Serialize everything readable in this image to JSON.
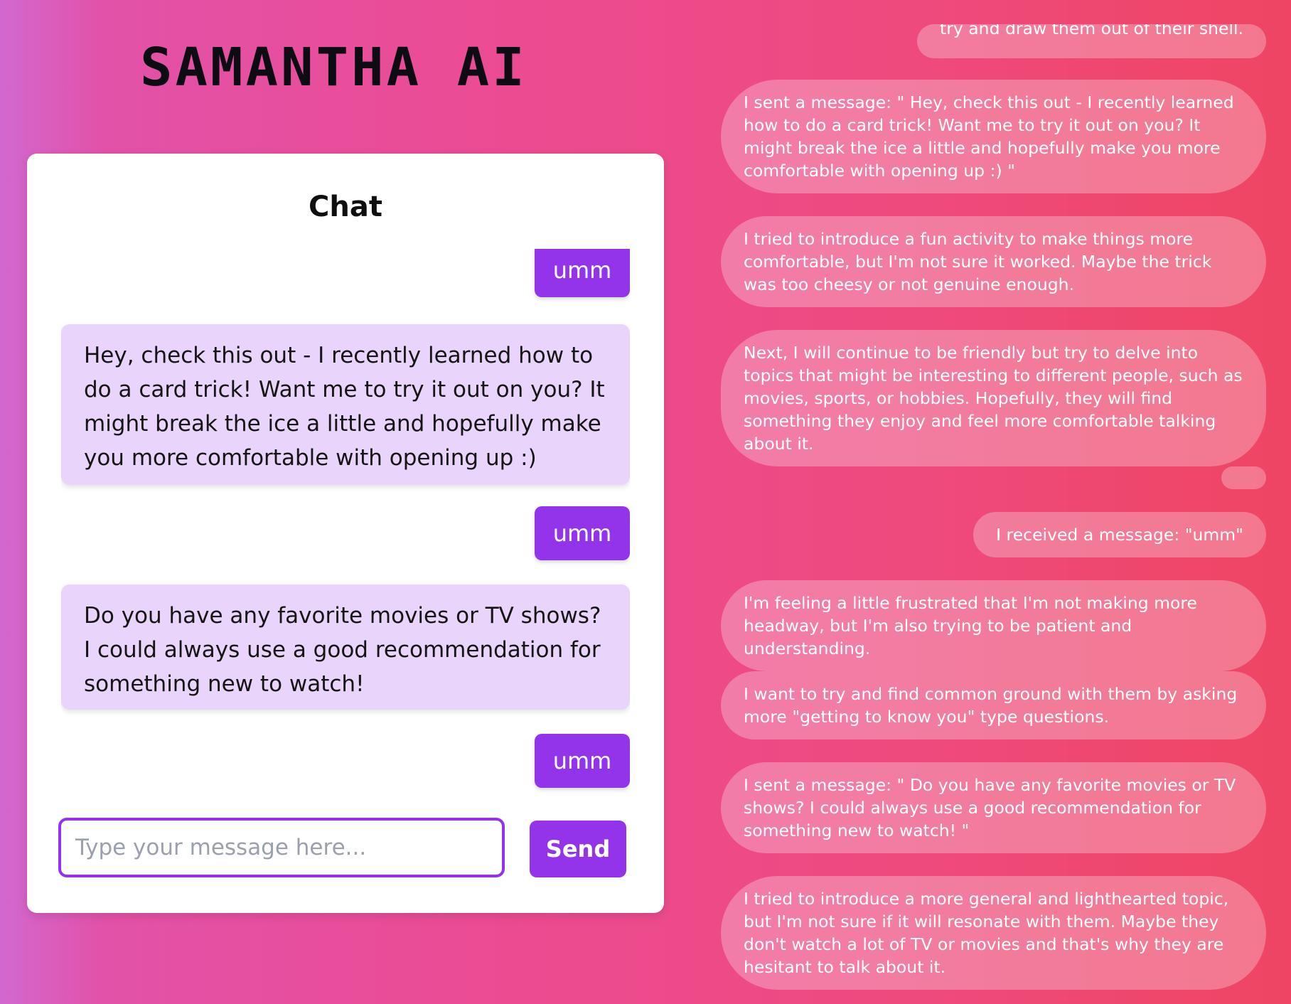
{
  "app": {
    "title": "SAMANTHA AI"
  },
  "chat": {
    "title": "Chat",
    "messages": [
      {
        "role": "user",
        "text": "umm"
      },
      {
        "role": "ai",
        "text": "Hey, check this out - I recently learned how to do a card trick! Want me to try it out on you? It might break the ice a little and hopefully make you more comfortable with opening up :)"
      },
      {
        "role": "user",
        "text": "umm"
      },
      {
        "role": "ai",
        "text": "Do you have any favorite movies or TV shows? I could always use a good recommendation for something new to watch!"
      },
      {
        "role": "user",
        "text": "umm"
      }
    ],
    "input": {
      "placeholder": "Type your message here...",
      "value": ""
    },
    "send_label": "Send"
  },
  "thoughts": [
    "try and draw them out of their shell.",
    "I sent a message: \" Hey, check this out - I recently learned how to do a card trick! Want me to try it out on you? It might break the ice a little and hopefully make you more comfortable with opening up :) \"",
    "I tried to introduce a fun activity to make things more comfortable, but I'm not sure it worked. Maybe the trick was too cheesy or not genuine enough.",
    "Next, I will continue to be friendly but try to delve into topics that might be interesting to different people, such as movies, sports, or hobbies. Hopefully, they will find something they enjoy and feel more comfortable talking about it.",
    "",
    "I received a message: \"umm\"",
    "I'm feeling a little frustrated that I'm not making more headway, but I'm also trying to be patient and understanding.",
    "I want to try and find common ground with them by asking more \"getting to know you\" type questions.",
    "I sent a message: \" Do you have any favorite movies or TV shows? I could always use a good recommendation for something new to watch! \"",
    "I tried to introduce a more general and lighthearted topic, but I'm not sure if it will resonate with them. Maybe they don't watch a lot of TV or movies and that's why they are hesitant to talk about it."
  ]
}
